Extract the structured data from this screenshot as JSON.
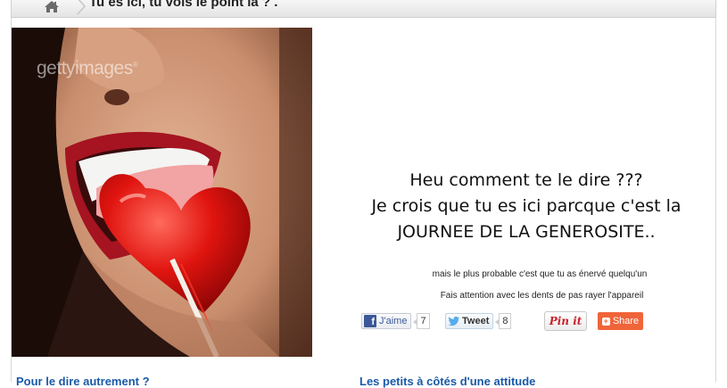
{
  "breadcrumb": {
    "home_icon": "home-icon",
    "separator_icon": "chevron-right-icon",
    "title": "Tu es ici, tu vois le point là ? ."
  },
  "image": {
    "watermark": "gettyimages",
    "watermark_mark": "®",
    "description_icon": "photo"
  },
  "headline": {
    "line1": "Heu comment te le dire ???",
    "line2": "Je crois que tu es ici parcque c'est la",
    "line3": "JOURNEE DE LA GENEROSITE.."
  },
  "subtext": {
    "line1": "mais le plus probable c'est que tu as énervé quelqu'un",
    "line2": "Fais attention avec les dents de pas rayer l'appareil"
  },
  "social": {
    "facebook": {
      "icon": "facebook-icon",
      "label": "J'aime",
      "count": "7"
    },
    "twitter": {
      "icon": "twitter-bird-icon",
      "label": "Tweet",
      "count": "8"
    },
    "pinterest": {
      "label": "Pin it"
    },
    "share": {
      "icon": "plus-icon",
      "label": "Share"
    }
  },
  "bottom_links": {
    "left": "Pour le dire autrement ?",
    "right": "Les petits à côtés d'une attitude"
  },
  "colors": {
    "link": "#1a5aa8",
    "share_bg": "#f0643a",
    "pin_red": "#c8232c",
    "facebook_blue": "#3b5998"
  }
}
